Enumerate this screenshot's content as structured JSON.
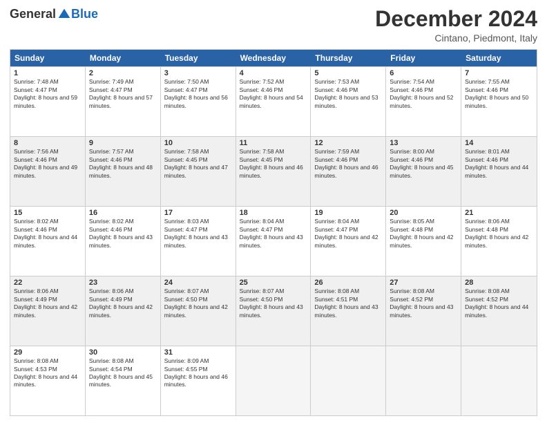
{
  "logo": {
    "general": "General",
    "blue": "Blue"
  },
  "title": "December 2024",
  "location": "Cintano, Piedmont, Italy",
  "header_days": [
    "Sunday",
    "Monday",
    "Tuesday",
    "Wednesday",
    "Thursday",
    "Friday",
    "Saturday"
  ],
  "weeks": [
    [
      {
        "day": "1",
        "sunrise": "7:48 AM",
        "sunset": "4:47 PM",
        "daylight": "8 hours and 59 minutes."
      },
      {
        "day": "2",
        "sunrise": "7:49 AM",
        "sunset": "4:47 PM",
        "daylight": "8 hours and 57 minutes."
      },
      {
        "day": "3",
        "sunrise": "7:50 AM",
        "sunset": "4:47 PM",
        "daylight": "8 hours and 56 minutes."
      },
      {
        "day": "4",
        "sunrise": "7:52 AM",
        "sunset": "4:46 PM",
        "daylight": "8 hours and 54 minutes."
      },
      {
        "day": "5",
        "sunrise": "7:53 AM",
        "sunset": "4:46 PM",
        "daylight": "8 hours and 53 minutes."
      },
      {
        "day": "6",
        "sunrise": "7:54 AM",
        "sunset": "4:46 PM",
        "daylight": "8 hours and 52 minutes."
      },
      {
        "day": "7",
        "sunrise": "7:55 AM",
        "sunset": "4:46 PM",
        "daylight": "8 hours and 50 minutes."
      }
    ],
    [
      {
        "day": "8",
        "sunrise": "7:56 AM",
        "sunset": "4:46 PM",
        "daylight": "8 hours and 49 minutes."
      },
      {
        "day": "9",
        "sunrise": "7:57 AM",
        "sunset": "4:46 PM",
        "daylight": "8 hours and 48 minutes."
      },
      {
        "day": "10",
        "sunrise": "7:58 AM",
        "sunset": "4:45 PM",
        "daylight": "8 hours and 47 minutes."
      },
      {
        "day": "11",
        "sunrise": "7:58 AM",
        "sunset": "4:45 PM",
        "daylight": "8 hours and 46 minutes."
      },
      {
        "day": "12",
        "sunrise": "7:59 AM",
        "sunset": "4:46 PM",
        "daylight": "8 hours and 46 minutes."
      },
      {
        "day": "13",
        "sunrise": "8:00 AM",
        "sunset": "4:46 PM",
        "daylight": "8 hours and 45 minutes."
      },
      {
        "day": "14",
        "sunrise": "8:01 AM",
        "sunset": "4:46 PM",
        "daylight": "8 hours and 44 minutes."
      }
    ],
    [
      {
        "day": "15",
        "sunrise": "8:02 AM",
        "sunset": "4:46 PM",
        "daylight": "8 hours and 44 minutes."
      },
      {
        "day": "16",
        "sunrise": "8:02 AM",
        "sunset": "4:46 PM",
        "daylight": "8 hours and 43 minutes."
      },
      {
        "day": "17",
        "sunrise": "8:03 AM",
        "sunset": "4:47 PM",
        "daylight": "8 hours and 43 minutes."
      },
      {
        "day": "18",
        "sunrise": "8:04 AM",
        "sunset": "4:47 PM",
        "daylight": "8 hours and 43 minutes."
      },
      {
        "day": "19",
        "sunrise": "8:04 AM",
        "sunset": "4:47 PM",
        "daylight": "8 hours and 42 minutes."
      },
      {
        "day": "20",
        "sunrise": "8:05 AM",
        "sunset": "4:48 PM",
        "daylight": "8 hours and 42 minutes."
      },
      {
        "day": "21",
        "sunrise": "8:06 AM",
        "sunset": "4:48 PM",
        "daylight": "8 hours and 42 minutes."
      }
    ],
    [
      {
        "day": "22",
        "sunrise": "8:06 AM",
        "sunset": "4:49 PM",
        "daylight": "8 hours and 42 minutes."
      },
      {
        "day": "23",
        "sunrise": "8:06 AM",
        "sunset": "4:49 PM",
        "daylight": "8 hours and 42 minutes."
      },
      {
        "day": "24",
        "sunrise": "8:07 AM",
        "sunset": "4:50 PM",
        "daylight": "8 hours and 42 minutes."
      },
      {
        "day": "25",
        "sunrise": "8:07 AM",
        "sunset": "4:50 PM",
        "daylight": "8 hours and 43 minutes."
      },
      {
        "day": "26",
        "sunrise": "8:08 AM",
        "sunset": "4:51 PM",
        "daylight": "8 hours and 43 minutes."
      },
      {
        "day": "27",
        "sunrise": "8:08 AM",
        "sunset": "4:52 PM",
        "daylight": "8 hours and 43 minutes."
      },
      {
        "day": "28",
        "sunrise": "8:08 AM",
        "sunset": "4:52 PM",
        "daylight": "8 hours and 44 minutes."
      }
    ],
    [
      {
        "day": "29",
        "sunrise": "8:08 AM",
        "sunset": "4:53 PM",
        "daylight": "8 hours and 44 minutes."
      },
      {
        "day": "30",
        "sunrise": "8:08 AM",
        "sunset": "4:54 PM",
        "daylight": "8 hours and 45 minutes."
      },
      {
        "day": "31",
        "sunrise": "8:09 AM",
        "sunset": "4:55 PM",
        "daylight": "8 hours and 46 minutes."
      },
      null,
      null,
      null,
      null
    ]
  ],
  "labels": {
    "sunrise": "Sunrise:",
    "sunset": "Sunset:",
    "daylight": "Daylight:"
  }
}
